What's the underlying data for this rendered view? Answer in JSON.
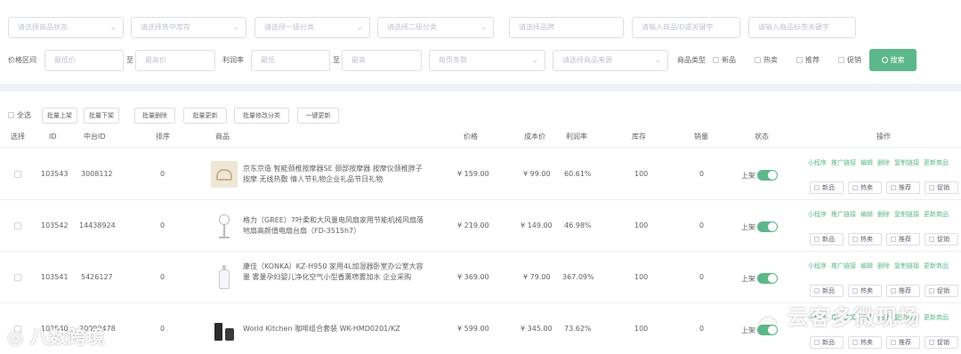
{
  "filters": {
    "row1": [
      "请选择商品状态",
      "请选择售中库存",
      "请选择一级分类",
      "请选择二级分类"
    ],
    "brand_placeholder": "请选择品牌",
    "id_placeholder": "请输入商品ID或关键字",
    "tag_placeholder": "请输入商品标签关键字",
    "price_label": "价格区间",
    "price_min_placeholder": "最低价",
    "to_label": "至",
    "price_max_placeholder": "最高价",
    "profit_label": "利润率",
    "profit_min_placeholder": "最低",
    "profit_max_placeholder": "最高",
    "page_size_placeholder": "每页条数",
    "source_placeholder": "请选择商品来源",
    "type_label": "商品类型",
    "type_options": [
      "新品",
      "热卖",
      "推荐",
      "促销"
    ],
    "search_button": "搜索"
  },
  "batch": {
    "select_all": "全选",
    "buttons": [
      "批量上架",
      "批量下架",
      "批量删除",
      "批量更新",
      "批量修改分类",
      "一键更新"
    ]
  },
  "table": {
    "headers": [
      "选择",
      "ID",
      "中台ID",
      "排序",
      "商品",
      "价格",
      "成本价",
      "利润率",
      "库存",
      "销量",
      "状态",
      "操作"
    ],
    "status_on": "上架",
    "ops_links": [
      "小程序",
      "推广链接",
      "编辑",
      "删除",
      "复制链接",
      "更新商品"
    ],
    "tag_buttons": [
      "新品",
      "热卖",
      "推荐",
      "促销"
    ],
    "rows": [
      {
        "id": "103543",
        "mid": "3008112",
        "sort": "0",
        "name": "京东京造 智能颈椎按摩器SE 颈部按摩器 按摩仪颈椎脖子按摩 无线热敷 情人节礼物企业礼品节日礼物",
        "price": "¥ 159.00",
        "cost": "¥ 99.00",
        "margin": "60.61%",
        "stock": "100",
        "sales": "0",
        "thumb": "massager"
      },
      {
        "id": "103542",
        "mid": "14438924",
        "sort": "0",
        "name": "格力（GREE）7叶柔和大风量电风扇家用节能机械风扇落地扇高颜值电扇台扇（FD-3515h7）",
        "price": "¥ 219.00",
        "cost": "¥ 149.00",
        "margin": "46.98%",
        "stock": "100",
        "sales": "0",
        "thumb": "fan"
      },
      {
        "id": "103541",
        "mid": "5426127",
        "sort": "0",
        "name": "康佳（KONKA）KZ-H950 家用4L加湿器卧室办公室大容量 雾量孕妇婴儿净化空气小型香薰喷雾加水 企业采购",
        "price": "¥ 369.00",
        "cost": "¥ 79.00",
        "margin": "367.09%",
        "stock": "100",
        "sales": "0",
        "thumb": "humidifier"
      },
      {
        "id": "103540",
        "mid": "20090478",
        "sort": "0",
        "name": "World Kitchen 咖啡组合套装 WK-HMD0201/KZ",
        "price": "¥ 599.00",
        "cost": "¥ 345.00",
        "margin": "73.62%",
        "stock": "100",
        "sales": "0",
        "thumb": "coffee"
      }
    ]
  },
  "watermarks": {
    "right": "云客多微现场",
    "left": "八数跨境"
  },
  "colors": {
    "accent": "#5cb88a",
    "border": "#dcdfe6",
    "placeholder": "#c0c4cc",
    "text": "#606266"
  }
}
